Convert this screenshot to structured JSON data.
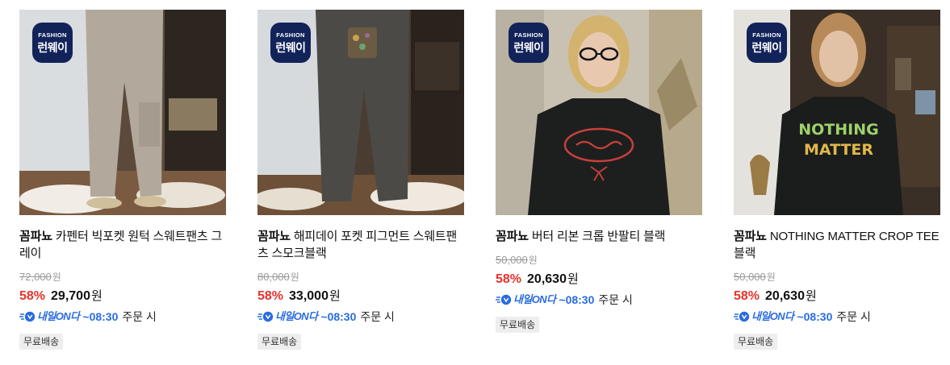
{
  "badge": {
    "top": "FASHION",
    "main": "런웨이"
  },
  "delivery": {
    "label": "내일ON다",
    "order_text": "주문 시"
  },
  "products": [
    {
      "brand": "꼼파뇨",
      "name": "카펜터 빅포켓 원턱 스웨트팬츠 그레이",
      "original_price": "72,000",
      "discount_rate": "58%",
      "sale_price": "29,700",
      "currency": "원",
      "delivery_time": "~08:30",
      "free_shipping": "무료배송",
      "image_icon": "gray-sweatpants-photo"
    },
    {
      "brand": "꼼파뇨",
      "name": "해피데이 포켓 피그먼트 스웨트팬츠 스모크블랙",
      "original_price": "80,000",
      "discount_rate": "58%",
      "sale_price": "33,000",
      "currency": "원",
      "delivery_time": "~08:30",
      "free_shipping": "무료배송",
      "image_icon": "smoke-black-sweatpants-photo"
    },
    {
      "brand": "꼼파뇨",
      "name": "버터 리본 크롭 반팔티 블랙",
      "original_price": "50,000",
      "discount_rate": "58%",
      "sale_price": "20,630",
      "currency": "원",
      "delivery_time": "~08:30",
      "free_shipping": "무료배송",
      "image_icon": "butter-tshirt-photo"
    },
    {
      "brand": "꼼파뇨",
      "name": "NOTHING MATTER CROP TEE 블랙",
      "original_price": "50,000",
      "discount_rate": "58%",
      "sale_price": "20,630",
      "currency": "원",
      "delivery_time": "~08:30",
      "free_shipping": "무료배송",
      "image_icon": "nothing-matter-tshirt-photo"
    }
  ],
  "colors": {
    "discount": "#e8322b",
    "delivery": "#2a6ce0",
    "badge_bg": "#12235a"
  }
}
